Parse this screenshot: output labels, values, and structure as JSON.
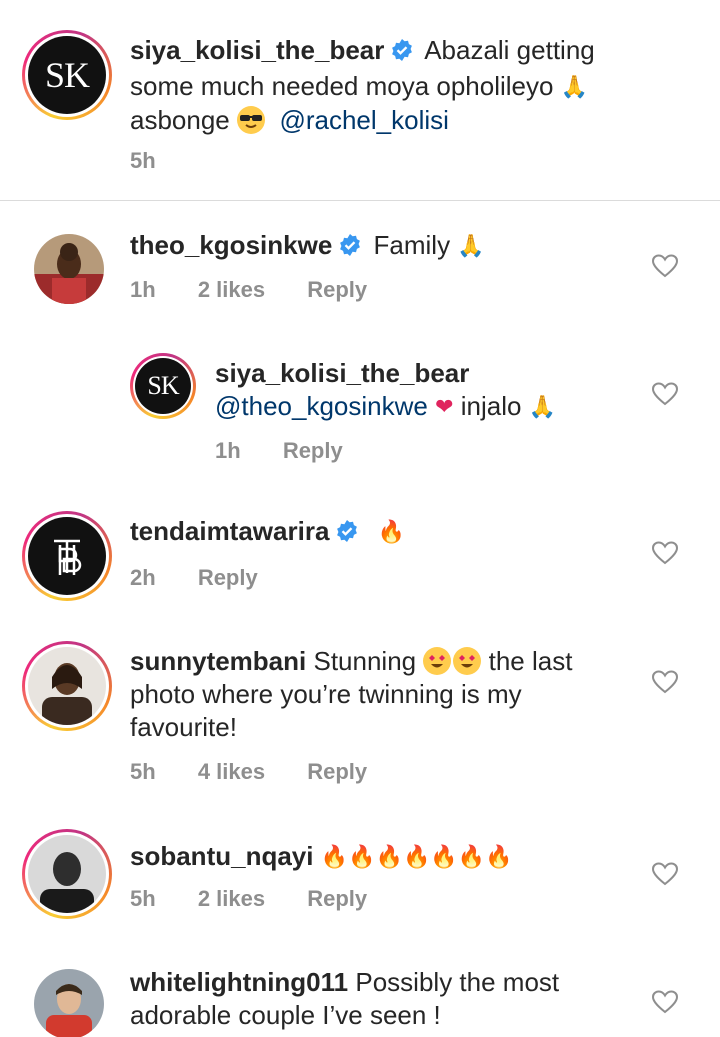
{
  "comments": [
    {
      "username": "siya_kolisi_the_bear",
      "text_1": "Abazali getting",
      "text_2": "some much needed moya opholileyo",
      "text_3": "asbonge",
      "mention": "@rachel_kolisi",
      "time": "5h",
      "avatar_initials": "SK"
    },
    {
      "username": "theo_kgosinkwe",
      "text": "Family",
      "time": "1h",
      "likes": "2 likes",
      "reply": "Reply"
    },
    {
      "username": "siya_kolisi_the_bear",
      "mention": "@theo_kgosinkwe",
      "text": "injalo",
      "time": "1h",
      "reply": "Reply",
      "avatar_initials": "SK"
    },
    {
      "username": "tendaimtawarira",
      "time": "2h",
      "reply": "Reply"
    },
    {
      "username": "sunnytembani",
      "text_1": "Stunning",
      "text_2": "the last",
      "text_3": "photo where you’re twinning is my",
      "text_4": "favourite!",
      "time": "5h",
      "likes": "4 likes",
      "reply": "Reply"
    },
    {
      "username": "sobantu_nqayi",
      "time": "5h",
      "likes": "2 likes",
      "reply": "Reply"
    },
    {
      "username": "whitelightning011",
      "text_1": "Possibly the most",
      "text_2": "adorable couple I’ve seen !"
    }
  ],
  "icons": {
    "verified": "verified-badge-icon",
    "like": "heart-outline-icon",
    "fire": "fire-emoji",
    "pray": "pray-emoji",
    "heart_eyes": "heart-eyes-emoji",
    "sunglasses": "sunglasses-emoji",
    "red_heart": "red-heart-emoji"
  },
  "colors": {
    "verified_blue": "#3897f0",
    "mention": "#00376b",
    "meta_gray": "#8e8e8e",
    "text": "#262626"
  }
}
